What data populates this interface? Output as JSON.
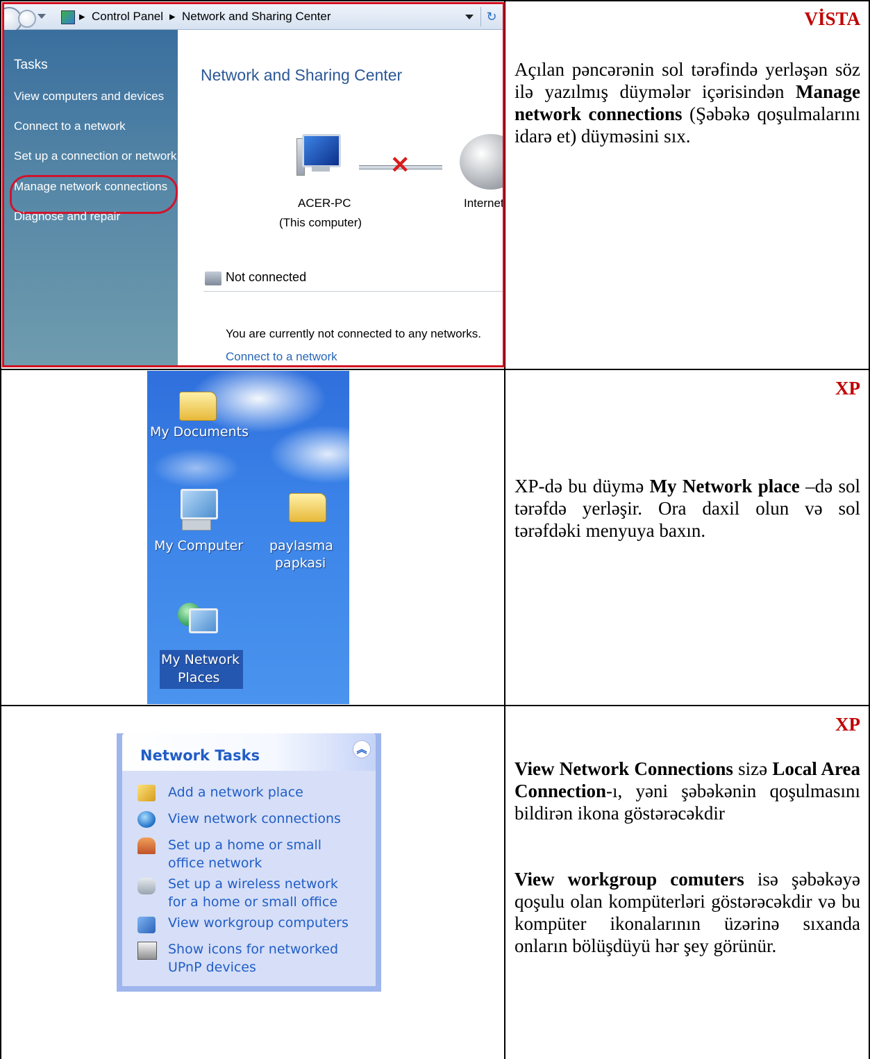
{
  "vista": {
    "label": "VİSTA",
    "breadcrumb": [
      "Control Panel",
      "Network and Sharing Center"
    ],
    "sidebar": {
      "heading": "Tasks",
      "items": [
        "View computers and devices",
        "Connect to a network",
        "Set up a connection or network",
        "Manage network connections",
        "Diagnose and repair"
      ]
    },
    "main": {
      "title": "Network and Sharing Center",
      "computer_name": "ACER-PC",
      "computer_sub": "(This computer)",
      "internet": "Internet",
      "status": "Not connected",
      "message": "You are currently not connected to any networks.",
      "connect_link": "Connect to a network"
    },
    "description": {
      "p1": "Açılan pəncərənin sol tərəfində yerləşən söz ilə yazılmış düymələr içərisindən ",
      "bold": "Manage network connections",
      "p2": " (Şəbəkə qoşulmalarını idarə et) düyməsini sıx."
    }
  },
  "xp_desktop": {
    "label": "XP",
    "icons": {
      "my_documents": "My Documents",
      "my_computer": "My Computer",
      "shared_folder_line1": "paylasma",
      "shared_folder_line2": "papkasi",
      "my_network_line1": "My Network",
      "my_network_line2": "Places"
    },
    "description": {
      "p1": "XP-də bu düymə ",
      "bold": "My Network place",
      "p2": " –də sol tərəfdə yerləşir. Ora daxil olun və sol tərəfdəki menyuya baxın."
    }
  },
  "xp_tasks": {
    "label": "XP",
    "panel_title": "Network Tasks",
    "items": [
      {
        "line1": "Add a network place",
        "line2": ""
      },
      {
        "line1": "View network connections",
        "line2": ""
      },
      {
        "line1": "Set up a home or small",
        "line2": "office network"
      },
      {
        "line1": "Set up a wireless network",
        "line2": "for a home or small office"
      },
      {
        "line1": "View workgroup computers",
        "line2": ""
      },
      {
        "line1": "Show icons for networked",
        "line2": "UPnP devices"
      }
    ],
    "description": {
      "b1": "View Network Connections",
      "t1": " sizə ",
      "b2": "Local Area Connection",
      "t2": "-ı, yəni şəbəkənin qoşulmasını bildirən ikona göstərəcəkdir",
      "b3": "View workgroup comuters",
      "t3": " isə şəbəkəyə qoşulu olan kompüterləri göstərəcəkdir və bu kompüter ikonalarının üzərinə sıxanda onların bölüşdüyü hər şey görünür."
    }
  },
  "colors": {
    "os_label": "#c00000",
    "vista_highlight": "#d10d1f",
    "xp_link": "#215dc6"
  }
}
